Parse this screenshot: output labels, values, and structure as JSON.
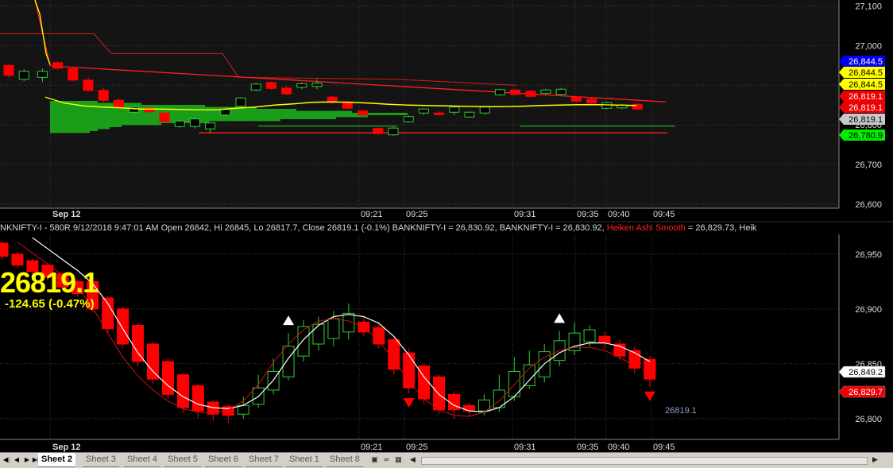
{
  "colors": {
    "background": "#000000",
    "panel_background": "#141414",
    "grid": "#3a3a3a",
    "bull_candle": "#000000",
    "bull_outline_top": "#33cc33",
    "bear_candle": "#ff0000",
    "avg_line": "#ffff00",
    "smooth_line": "#ffffff",
    "volume_profile": "#1a9e1a",
    "trend_line": "#ff2020",
    "arrow_down": "#ff0000",
    "arrow_up": "#ffffff"
  },
  "info_line": {
    "text": "NKNIFTY-I - 580R 9/12/2018 9:47:01 AM Open 26842, Hi 26845, Lo 26817.7, Close 26819.1 (-0.1%) BANKNIFTY-I = 26,830.92, BANKNIFTY-I = 26,830.92,",
    "indicator": "Heiken Ashi Smooth",
    "indicator_value": "= 26,829.73, Heik"
  },
  "last_price": "26819.1",
  "change": "-124.65 (-0.47%)",
  "tabs": {
    "active": "Sheet 2",
    "items": [
      "Sheet 3",
      "Sheet 4",
      "Sheet 5",
      "Sheet 6",
      "Sheet 7",
      "Sheet 1",
      "Sheet 8"
    ]
  },
  "chart_data": [
    {
      "type": "candlestick",
      "title": "",
      "x_axis_labels": [
        "Sep 12",
        "09:21",
        "09:25",
        "09:31",
        "09:35",
        "09:40",
        "09:45"
      ],
      "y_axis_ticks": [
        "26,600",
        "26,700",
        "26,800",
        "27,000",
        "27,100"
      ],
      "ylim": [
        26590,
        27115
      ],
      "price_badges": [
        {
          "text": "26,844.5",
          "bg": "#0000ee",
          "fg": "#ffffff"
        },
        {
          "text": "26,844.5",
          "bg": "#ffff00",
          "fg": "#000000"
        },
        {
          "text": "26,844.5",
          "bg": "#ffff00",
          "fg": "#000000"
        },
        {
          "text": "26,819.1",
          "bg": "#ee0000",
          "fg": "#ffffff"
        },
        {
          "text": "26,819.1",
          "bg": "#ee0000",
          "fg": "#ffffff"
        },
        {
          "text": "26,819.1",
          "bg": "#c8c8c8",
          "fg": "#000000"
        },
        {
          "text": "26,780.9",
          "bg": "#00ee00",
          "fg": "#000000"
        }
      ],
      "candles": [
        {
          "o": 26950,
          "c": 26925,
          "h": 26955,
          "l": 26920
        },
        {
          "o": 26915,
          "c": 26935,
          "h": 26940,
          "l": 26910
        },
        {
          "o": 26920,
          "c": 26935,
          "h": 26942,
          "l": 26908
        },
        {
          "o": 26957,
          "c": 26943,
          "h": 26960,
          "l": 26940
        },
        {
          "o": 26942,
          "c": 26913,
          "h": 26948,
          "l": 26910
        },
        {
          "o": 26913,
          "c": 26887,
          "h": 26920,
          "l": 26883
        },
        {
          "o": 26887,
          "c": 26862,
          "h": 26893,
          "l": 26858
        },
        {
          "o": 26862,
          "c": 26845,
          "h": 26867,
          "l": 26840
        },
        {
          "o": 26832,
          "c": 26845,
          "h": 26848,
          "l": 26828
        },
        {
          "o": 26842,
          "c": 26833,
          "h": 26847,
          "l": 26829
        },
        {
          "o": 26830,
          "c": 26808,
          "h": 26835,
          "l": 26805
        },
        {
          "o": 26796,
          "c": 26810,
          "h": 26814,
          "l": 26792
        },
        {
          "o": 26796,
          "c": 26815,
          "h": 26818,
          "l": 26791
        },
        {
          "o": 26790,
          "c": 26805,
          "h": 26807,
          "l": 26780
        },
        {
          "o": 26825,
          "c": 26839,
          "h": 26842,
          "l": 26822
        },
        {
          "o": 26847,
          "c": 26868,
          "h": 26870,
          "l": 26844
        },
        {
          "o": 26888,
          "c": 26903,
          "h": 26906,
          "l": 26885
        },
        {
          "o": 26907,
          "c": 26892,
          "h": 26910,
          "l": 26889
        },
        {
          "o": 26893,
          "c": 26878,
          "h": 26898,
          "l": 26875
        },
        {
          "o": 26895,
          "c": 26904,
          "h": 26907,
          "l": 26890
        },
        {
          "o": 26897,
          "c": 26905,
          "h": 26915,
          "l": 26890
        },
        {
          "o": 26870,
          "c": 26857,
          "h": 26873,
          "l": 26853
        },
        {
          "o": 26858,
          "c": 26842,
          "h": 26861,
          "l": 26839
        },
        {
          "o": 26835,
          "c": 26825,
          "h": 26838,
          "l": 26822
        },
        {
          "o": 26791,
          "c": 26778,
          "h": 26794,
          "l": 26775
        },
        {
          "o": 26775,
          "c": 26792,
          "h": 26795,
          "l": 26772
        },
        {
          "o": 26808,
          "c": 26821,
          "h": 26824,
          "l": 26805
        },
        {
          "o": 26830,
          "c": 26840,
          "h": 26842,
          "l": 26825
        },
        {
          "o": 26830,
          "c": 26826,
          "h": 26835,
          "l": 26822
        },
        {
          "o": 26832,
          "c": 26845,
          "h": 26847,
          "l": 26825
        },
        {
          "o": 26820,
          "c": 26832,
          "h": 26834,
          "l": 26818
        },
        {
          "o": 26830,
          "c": 26845,
          "h": 26848,
          "l": 26826
        },
        {
          "o": 26876,
          "c": 26889,
          "h": 26891,
          "l": 26873
        },
        {
          "o": 26888,
          "c": 26877,
          "h": 26891,
          "l": 26874
        },
        {
          "o": 26885,
          "c": 26872,
          "h": 26888,
          "l": 26869
        },
        {
          "o": 26880,
          "c": 26888,
          "h": 26891,
          "l": 26876
        },
        {
          "o": 26877,
          "c": 26890,
          "h": 26893,
          "l": 26874
        },
        {
          "o": 26870,
          "c": 26860,
          "h": 26873,
          "l": 26856
        },
        {
          "o": 26865,
          "c": 26855,
          "h": 26868,
          "l": 26852
        },
        {
          "o": 26842,
          "c": 26856,
          "h": 26859,
          "l": 26840
        },
        {
          "o": 26843,
          "c": 26850,
          "h": 26853,
          "l": 26840
        },
        {
          "o": 26852,
          "c": 26840,
          "h": 26855,
          "l": 26837
        }
      ],
      "avg_line": [
        26870,
        26855,
        26848,
        26845,
        26843,
        26840,
        26840,
        26839,
        26838,
        26838,
        26842,
        26845,
        26850,
        26853,
        26857,
        26858,
        26857,
        26855,
        26852,
        26850,
        26849,
        26848,
        26847,
        26846,
        26846,
        26847,
        26849,
        26850,
        26851,
        26851,
        26850,
        26849
      ]
    },
    {
      "type": "candlestick",
      "title": "",
      "x_axis_labels": [
        "Sep 12",
        "09:21",
        "09:25",
        "09:31",
        "09:35",
        "09:40",
        "09:45"
      ],
      "y_axis_ticks": [
        "26,800",
        "26,850",
        "26,900",
        "26,950"
      ],
      "ylim": [
        26781,
        26968
      ],
      "series": [
        {
          "name": "Heiken Ashi Smooth",
          "current": "26,829.73"
        }
      ],
      "price_badges": [
        {
          "text": "26,849.2",
          "bg": "#ffffff",
          "fg": "#000000"
        },
        {
          "text": "26,829.7",
          "bg": "#ee0000",
          "fg": "#ffffff"
        }
      ],
      "annotations": [
        "26819.1"
      ],
      "candles": [
        {
          "o": 26960,
          "c": 26948,
          "h": 26962,
          "l": 26945
        },
        {
          "o": 26950,
          "c": 26940,
          "h": 26952,
          "l": 26937
        },
        {
          "o": 26944,
          "c": 26934,
          "h": 26946,
          "l": 26931
        },
        {
          "o": 26940,
          "c": 26929,
          "h": 26942,
          "l": 26926
        },
        {
          "o": 26932,
          "c": 26920,
          "h": 26934,
          "l": 26917
        },
        {
          "o": 26925,
          "c": 26914,
          "h": 26927,
          "l": 26911
        },
        {
          "o": 26925,
          "c": 26900,
          "h": 26927,
          "l": 26897
        },
        {
          "o": 26910,
          "c": 26882,
          "h": 26912,
          "l": 26878
        },
        {
          "o": 26900,
          "c": 26868,
          "h": 26902,
          "l": 26864
        },
        {
          "o": 26885,
          "c": 26852,
          "h": 26888,
          "l": 26848
        },
        {
          "o": 26868,
          "c": 26836,
          "h": 26870,
          "l": 26832
        },
        {
          "o": 26852,
          "c": 26822,
          "h": 26855,
          "l": 26818
        },
        {
          "o": 26840,
          "c": 26810,
          "h": 26842,
          "l": 26805
        },
        {
          "o": 26830,
          "c": 26807,
          "h": 26832,
          "l": 26800
        },
        {
          "o": 26815,
          "c": 26804,
          "h": 26817,
          "l": 26798
        },
        {
          "o": 26811,
          "c": 26803,
          "h": 26813,
          "l": 26796
        },
        {
          "o": 26804,
          "c": 26812,
          "h": 26820,
          "l": 26800
        },
        {
          "o": 26813,
          "c": 26828,
          "h": 26840,
          "l": 26810
        },
        {
          "o": 26826,
          "c": 26843,
          "h": 26855,
          "l": 26822
        },
        {
          "o": 26838,
          "c": 26866,
          "h": 26878,
          "l": 26835
        },
        {
          "o": 26857,
          "c": 26884,
          "h": 26890,
          "l": 26852
        },
        {
          "o": 26868,
          "c": 26886,
          "h": 26893,
          "l": 26862
        },
        {
          "o": 26873,
          "c": 26891,
          "h": 26898,
          "l": 26866
        },
        {
          "o": 26879,
          "c": 26896,
          "h": 26905,
          "l": 26872
        },
        {
          "o": 26888,
          "c": 26879,
          "h": 26893,
          "l": 26875
        },
        {
          "o": 26883,
          "c": 26868,
          "h": 26888,
          "l": 26864
        },
        {
          "o": 26872,
          "c": 26845,
          "h": 26875,
          "l": 26840
        },
        {
          "o": 26860,
          "c": 26828,
          "h": 26864,
          "l": 26823
        },
        {
          "o": 26848,
          "c": 26818,
          "h": 26850,
          "l": 26813
        },
        {
          "o": 26838,
          "c": 26808,
          "h": 26840,
          "l": 26804
        },
        {
          "o": 26822,
          "c": 26808,
          "h": 26825,
          "l": 26800
        },
        {
          "o": 26812,
          "c": 26807,
          "h": 26815,
          "l": 26802
        },
        {
          "o": 26807,
          "c": 26817,
          "h": 26822,
          "l": 26803
        },
        {
          "o": 26810,
          "c": 26826,
          "h": 26840,
          "l": 26806
        },
        {
          "o": 26820,
          "c": 26843,
          "h": 26856,
          "l": 26816
        },
        {
          "o": 26830,
          "c": 26849,
          "h": 26862,
          "l": 26827
        },
        {
          "o": 26838,
          "c": 26861,
          "h": 26868,
          "l": 26833
        },
        {
          "o": 26853,
          "c": 26871,
          "h": 26880,
          "l": 26848
        },
        {
          "o": 26862,
          "c": 26878,
          "h": 26888,
          "l": 26858
        },
        {
          "o": 26870,
          "c": 26881,
          "h": 26885,
          "l": 26866
        },
        {
          "o": 26875,
          "c": 26869,
          "h": 26879,
          "l": 26864
        },
        {
          "o": 26868,
          "c": 26857,
          "h": 26872,
          "l": 26853
        },
        {
          "o": 26862,
          "c": 26846,
          "h": 26866,
          "l": 26841
        },
        {
          "o": 26854,
          "c": 26836,
          "h": 26857,
          "l": 26829
        }
      ],
      "signals": [
        {
          "candle": 19,
          "kind": "buy"
        },
        {
          "candle": 27,
          "kind": "sell"
        },
        {
          "candle": 37,
          "kind": "buy"
        },
        {
          "candle": 43,
          "kind": "sell"
        }
      ],
      "smooth_line": [
        26965,
        26955,
        26945,
        26935,
        26923,
        26905,
        26882,
        26860,
        26843,
        26830,
        26820,
        26813,
        26810,
        26809,
        26812,
        26820,
        26835,
        26855,
        26872,
        26885,
        26893,
        26895,
        26893,
        26887,
        26875,
        26858,
        26838,
        26822,
        26812,
        26807,
        26806,
        26810,
        26820,
        26835,
        26850,
        26860,
        26866,
        26869,
        26869,
        26866,
        26860,
        26852
      ]
    }
  ]
}
